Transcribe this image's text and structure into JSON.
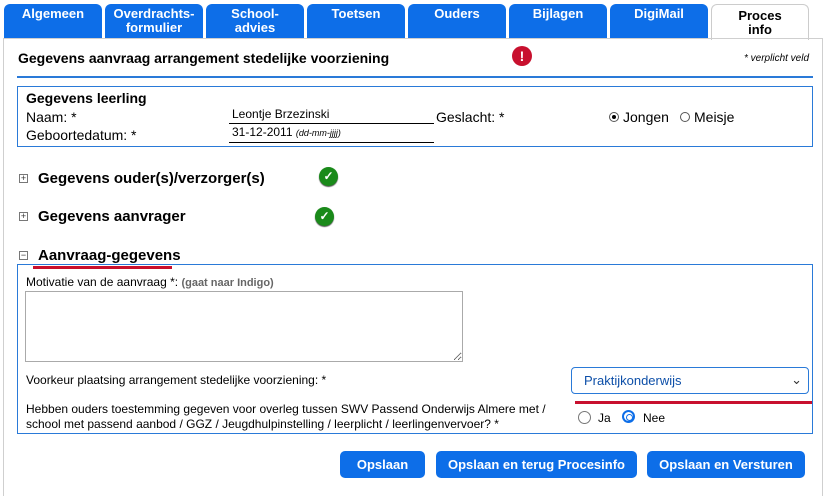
{
  "tabs": [
    {
      "label": "Algemeen"
    },
    {
      "label1": "Overdrachts-",
      "label2": "formulier"
    },
    {
      "label1": "School-",
      "label2": "advies"
    },
    {
      "label": "Toetsen"
    },
    {
      "label": "Ouders"
    },
    {
      "label": "Bijlagen"
    },
    {
      "label": "DigiMail"
    },
    {
      "label1": "Proces",
      "label2": "info"
    }
  ],
  "header": {
    "title": "Gegevens aanvraag arrangement stedelijke voorziening",
    "required_note": "* verplicht veld",
    "error_glyph": "!"
  },
  "student": {
    "section_title": "Gegevens leerling",
    "name_label": "Naam: *",
    "name_value": "Leontje Brzezinski",
    "dob_label": "Geboortedatum: *",
    "dob_value": "31-12-2011",
    "dob_format": "(dd-mm-jjjj)",
    "gender_label": "Geslacht: *",
    "gender_options": [
      "Jongen",
      "Meisje"
    ],
    "gender_selected": "Jongen"
  },
  "sections": {
    "parents": "Gegevens ouder(s)/verzorger(s)",
    "applicant": "Gegevens aanvrager",
    "request": "Aanvraag-gegevens",
    "collapsed_glyph": "⊞",
    "expanded_glyph": "⊟",
    "check_glyph": "✓"
  },
  "request": {
    "motivation_label": "Motivatie van de aanvraag *:",
    "motivation_hint": "(gaat naar Indigo)",
    "motivation_value": "",
    "preference_label": "Voorkeur plaatsing arrangement stedelijke voorziening: *",
    "preference_value": "Praktijkonderwijs",
    "consent_label_1": "Hebben ouders toestemming gegeven voor overleg tussen SWV Passend Onderwijs Almere met /",
    "consent_label_2": "school met passend aanbod / GGZ / Jeugdhulpinstelling / leerplicht / leerlingenvervoer? *",
    "consent_options": [
      "Ja",
      "Nee"
    ],
    "consent_selected": "Nee"
  },
  "buttons": {
    "save": "Opslaan",
    "save_back": "Opslaan en terug Procesinfo",
    "save_send": "Opslaan en Versturen"
  },
  "colors": {
    "accent": "#0d6ee8",
    "error": "#c8102e",
    "success": "#1a8a1a"
  }
}
